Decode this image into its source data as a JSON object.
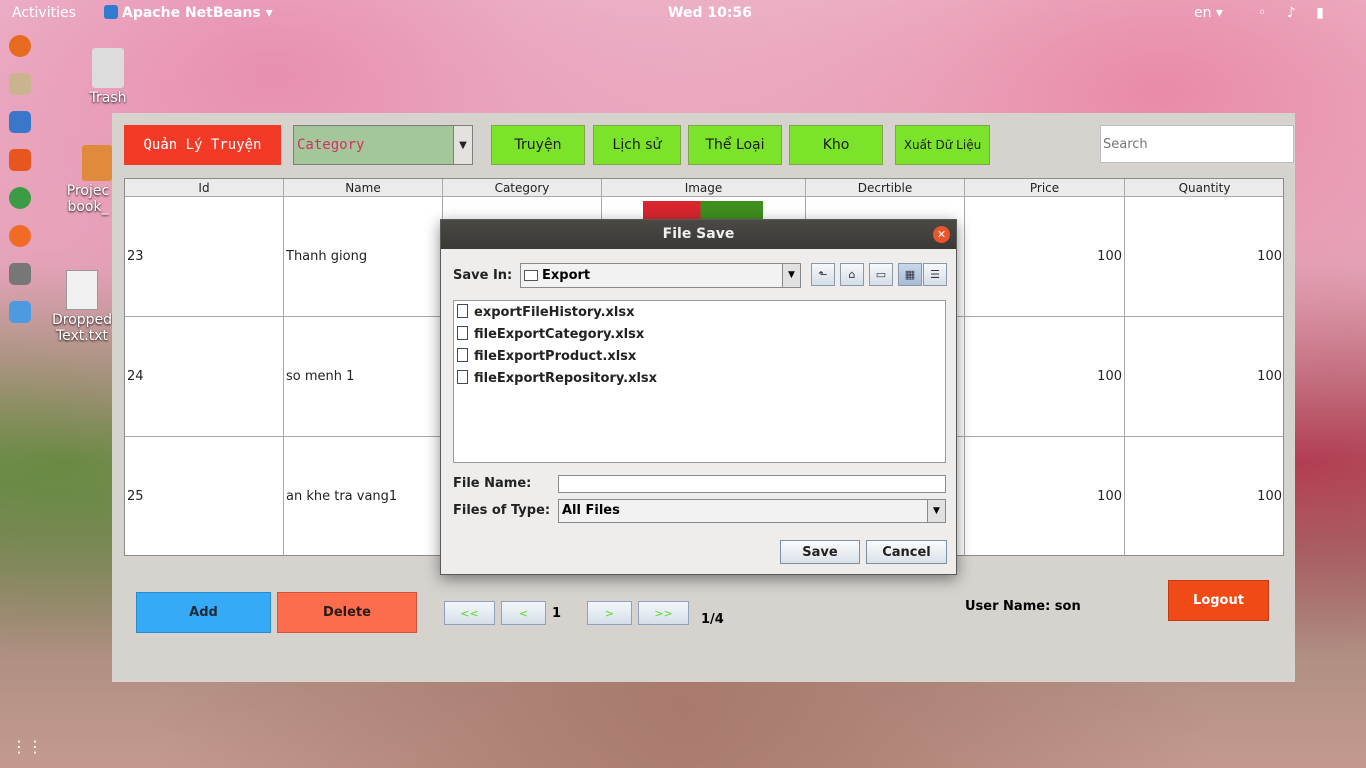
{
  "topbar": {
    "activities": "Activities",
    "app_name": "Apache NetBeans ▾",
    "clock": "Wed 10:56",
    "lang": "en ▾",
    "tray": "◦ ♪ ▮"
  },
  "desktop": {
    "trash_label": "Trash",
    "project_label_1": "Projec",
    "project_label_2": "book_",
    "dropped_label_1": "Dropped",
    "dropped_label_2": "Text.txt"
  },
  "toolbar": {
    "manage_label": "Quản Lý Truyện",
    "category_value": "Category",
    "btn_truyen": "Truyện",
    "btn_lichsu": "Lịch sử",
    "btn_theloai": "Thể Loại",
    "btn_kho": "Kho",
    "btn_export": "Xuất Dữ Liệu",
    "search_placeholder": "Search"
  },
  "table": {
    "headers": [
      "Id",
      "Name",
      "Category",
      "Image",
      "Decrtible",
      "Price",
      "Quantity"
    ],
    "rows": [
      {
        "id": "23",
        "name": "Thanh giong",
        "price": "100",
        "quantity": "100"
      },
      {
        "id": "24",
        "name": "so menh 1",
        "price": "100",
        "quantity": "100"
      },
      {
        "id": "25",
        "name": "an khe tra vang1",
        "price": "100",
        "quantity": "100"
      }
    ]
  },
  "bottom": {
    "add_label": "Add",
    "delete_label": "Delete",
    "first_label": "<<",
    "prev_label": "<",
    "page_num": "1",
    "next_label": ">",
    "last_label": ">>",
    "page_total": "1/4",
    "user_text": "User Name: son",
    "logout_label": "Logout"
  },
  "dialog": {
    "title": "File Save",
    "save_in_label": "Save In:",
    "save_in_value": "Export",
    "files": [
      "exportFileHistory.xlsx",
      "fileExportCategory.xlsx",
      "fileExportProduct.xlsx",
      "fileExportRepository.xlsx"
    ],
    "file_name_label": "File Name:",
    "file_name_value": "",
    "files_of_type_label": "Files of Type:",
    "files_of_type_value": "All Files",
    "save_label": "Save",
    "cancel_label": "Cancel"
  }
}
